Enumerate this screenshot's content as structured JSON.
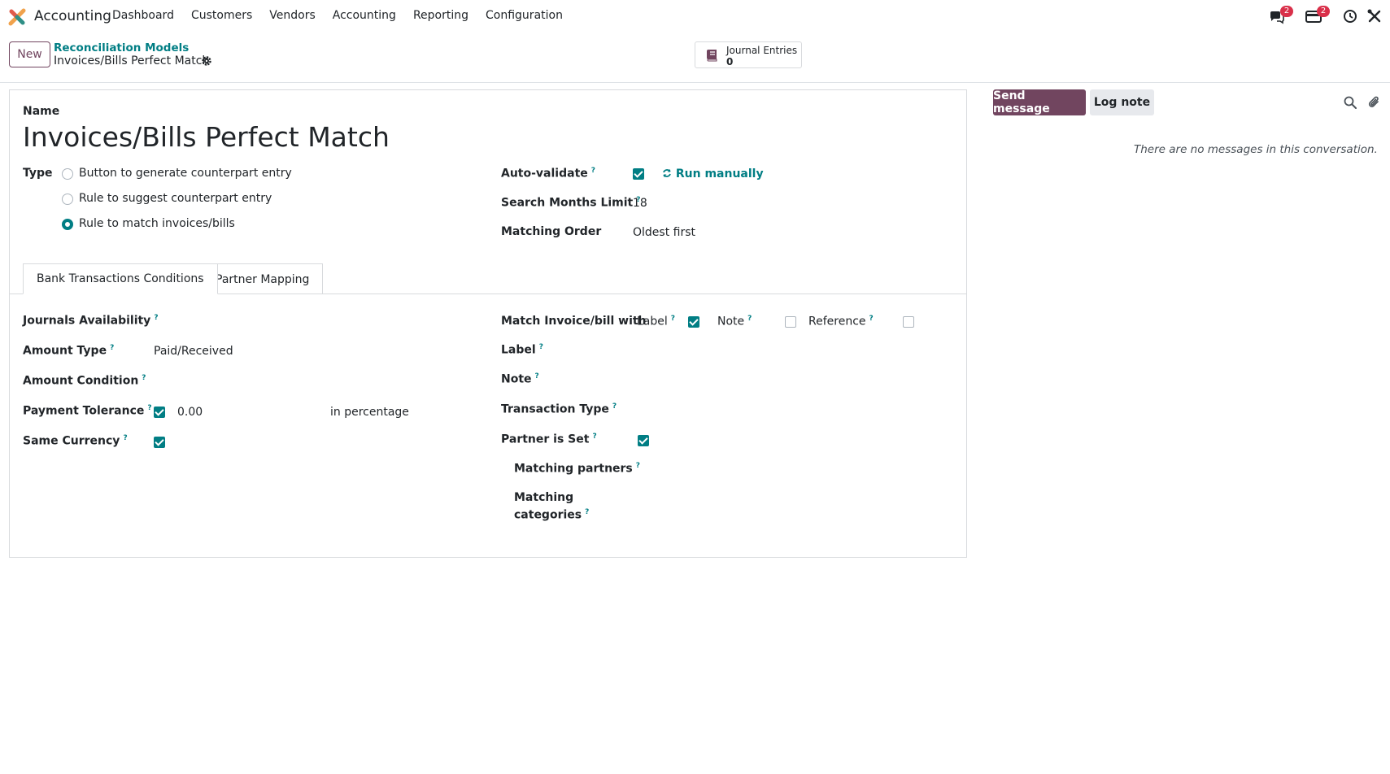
{
  "navbar": {
    "app_name": "Accounting",
    "menu": [
      "Dashboard",
      "Customers",
      "Vendors",
      "Accounting",
      "Reporting",
      "Configuration"
    ],
    "messages_badge": "2",
    "activities_badge": "2",
    "icons": [
      "app-logo",
      "messages-icon",
      "activities-icon",
      "clock-icon",
      "debug-icon"
    ]
  },
  "control_panel": {
    "new_label": "New",
    "breadcrumb_parent": "Reconciliation Models",
    "breadcrumb_current": "Invoices/Bills Perfect Match",
    "smart_button": {
      "label": "Journal Entries",
      "value": "0"
    }
  },
  "form": {
    "name_label": "Name",
    "name_value": "Invoices/Bills Perfect Match",
    "type_label": "Type",
    "type_options": [
      {
        "label": "Button to generate counterpart entry",
        "selected": false
      },
      {
        "label": "Rule to suggest counterpart entry",
        "selected": false
      },
      {
        "label": "Rule to match invoices/bills",
        "selected": true
      }
    ],
    "auto_validate_label": "Auto-validate",
    "auto_validate_checked": true,
    "run_manually_label": "Run manually",
    "search_months_label": "Search Months Limit",
    "search_months_value": "18",
    "matching_order_label": "Matching Order",
    "matching_order_value": "Oldest first",
    "help_marker": "?"
  },
  "tabs": [
    {
      "label": "Bank Transactions Conditions",
      "active": true
    },
    {
      "label": "Partner Mapping",
      "active": false
    }
  ],
  "conditions": {
    "journals_availability_label": "Journals Availability",
    "amount_type_label": "Amount Type",
    "amount_type_value": "Paid/Received",
    "amount_condition_label": "Amount Condition",
    "payment_tolerance_label": "Payment Tolerance",
    "payment_tolerance_checked": true,
    "payment_tolerance_value": "0.00",
    "payment_tolerance_unit": "in percentage",
    "same_currency_label": "Same Currency",
    "same_currency_checked": true,
    "match_with_label": "Match Invoice/bill with",
    "match_label_label": "Label",
    "match_label_checked": true,
    "match_note_label": "Note",
    "match_note_checked": false,
    "match_reference_label": "Reference",
    "match_reference_checked": false,
    "label_label": "Label",
    "note_label": "Note",
    "transaction_type_label": "Transaction Type",
    "partner_is_set_label": "Partner is Set",
    "partner_is_set_checked": true,
    "matching_partners_label": "Matching partners",
    "matching_categories_label_1": "Matching",
    "matching_categories_label_2": "categories"
  },
  "chatter": {
    "send_message_label": "Send message",
    "log_note_label": "Log note",
    "empty_text": "There are no messages in this conversation."
  },
  "colors": {
    "primary": "#71455f",
    "accent": "#017e84",
    "badge": "#d9304a"
  }
}
